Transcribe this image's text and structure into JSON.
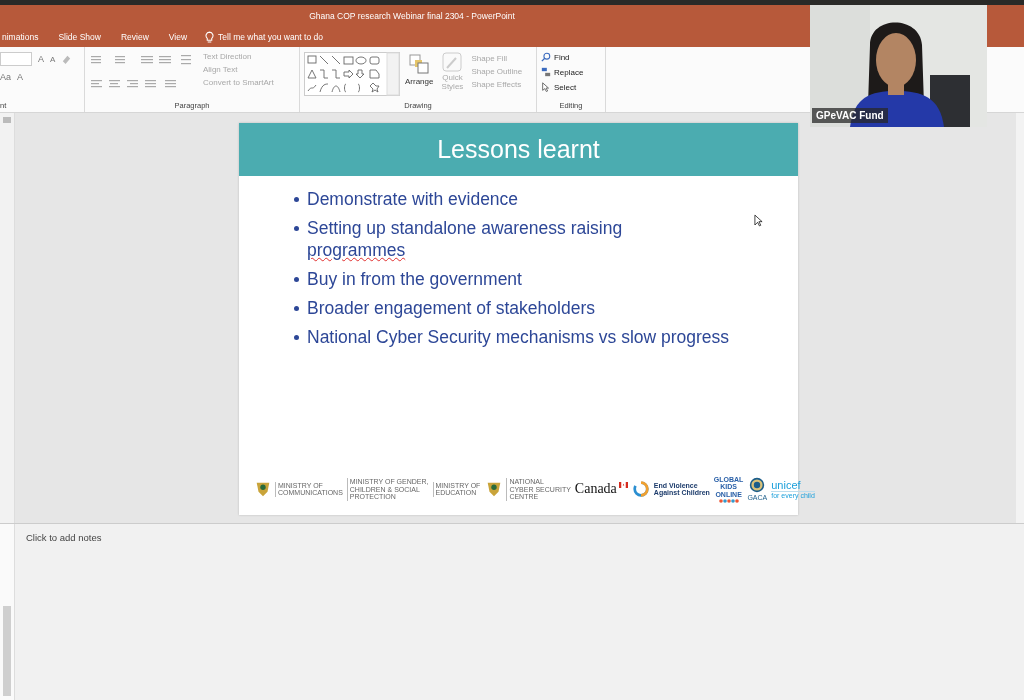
{
  "title_bar": {
    "title": "Ghana COP research Webinar final 2304  -  PowerPoint"
  },
  "tabs": [
    {
      "label": "nimations",
      "selected": false
    },
    {
      "label": "Slide Show",
      "selected": false
    },
    {
      "label": "Review",
      "selected": false
    },
    {
      "label": "View",
      "selected": false
    }
  ],
  "tell_me": {
    "placeholder": "Tell me what you want to do"
  },
  "ribbon": {
    "font": {
      "label": "nt",
      "glyphs": [
        "A",
        "A",
        "Aa",
        "A"
      ]
    },
    "paragraph": {
      "label": "Paragraph",
      "commands": [
        {
          "label": "Text Direction",
          "disabled": true
        },
        {
          "label": "Align Text",
          "disabled": true
        },
        {
          "label": "Convert to SmartArt",
          "disabled": true
        }
      ]
    },
    "drawing": {
      "label": "Drawing",
      "arrange": {
        "label": "Arrange"
      },
      "quick_styles": {
        "label": "Quick Styles",
        "disabled": true
      },
      "commands": [
        {
          "label": "Shape Fill",
          "disabled": true
        },
        {
          "label": "Shape Outline",
          "disabled": true
        },
        {
          "label": "Shape Effects",
          "disabled": true
        }
      ]
    },
    "editing": {
      "label": "Editing",
      "commands": [
        {
          "label": "Find",
          "kind": "find"
        },
        {
          "label": "Replace",
          "kind": "replace"
        },
        {
          "label": "Select",
          "kind": "select"
        }
      ]
    }
  },
  "slide": {
    "title": "Lessons learnt",
    "bullets": [
      {
        "lines": [
          [
            {
              "text": "Demonstrate with evidence",
              "misspelled": false
            }
          ]
        ]
      },
      {
        "lines": [
          [
            {
              "text": "Setting up standalone awareness raising",
              "misspelled": false
            }
          ],
          [
            {
              "text": "programmes",
              "misspelled": true
            }
          ]
        ]
      },
      {
        "lines": [
          [
            {
              "text": "Buy in from the government",
              "misspelled": false
            }
          ]
        ]
      },
      {
        "lines": [
          [
            {
              "text": "Broader engagement of stakeholders",
              "misspelled": false
            }
          ]
        ]
      },
      {
        "lines": [
          [
            {
              "text": "National Cyber Security mechanisms vs slow progress",
              "misspelled": false
            }
          ]
        ]
      }
    ],
    "logos": [
      {
        "kind": "crest",
        "lines": [
          "MINISTRY OF",
          "COMMUNICATIONS"
        ]
      },
      {
        "kind": "text",
        "lines": [
          "MINISTRY OF GENDER,",
          "CHILDREN & SOCIAL",
          "PROTECTION"
        ]
      },
      {
        "kind": "text",
        "lines": [
          "MINISTRY OF",
          "EDUCATION"
        ]
      },
      {
        "kind": "crest",
        "lines": [
          "NATIONAL",
          "CYBER SECURITY",
          "CENTRE"
        ]
      },
      {
        "kind": "canada",
        "lines": [
          "Canada"
        ]
      },
      {
        "kind": "ring",
        "lines": [
          "End Violence",
          "Against Children"
        ]
      },
      {
        "kind": "stack",
        "lines": [
          "GLOBAL",
          "KIDS",
          "ONLINE"
        ]
      },
      {
        "kind": "seal",
        "lines": [
          "GACA"
        ]
      },
      {
        "kind": "unicef",
        "lines": [
          "unicef",
          "for every child"
        ]
      }
    ]
  },
  "notes": {
    "placeholder": "Click to add notes"
  },
  "video": {
    "name": "GPeVAC Fund"
  }
}
